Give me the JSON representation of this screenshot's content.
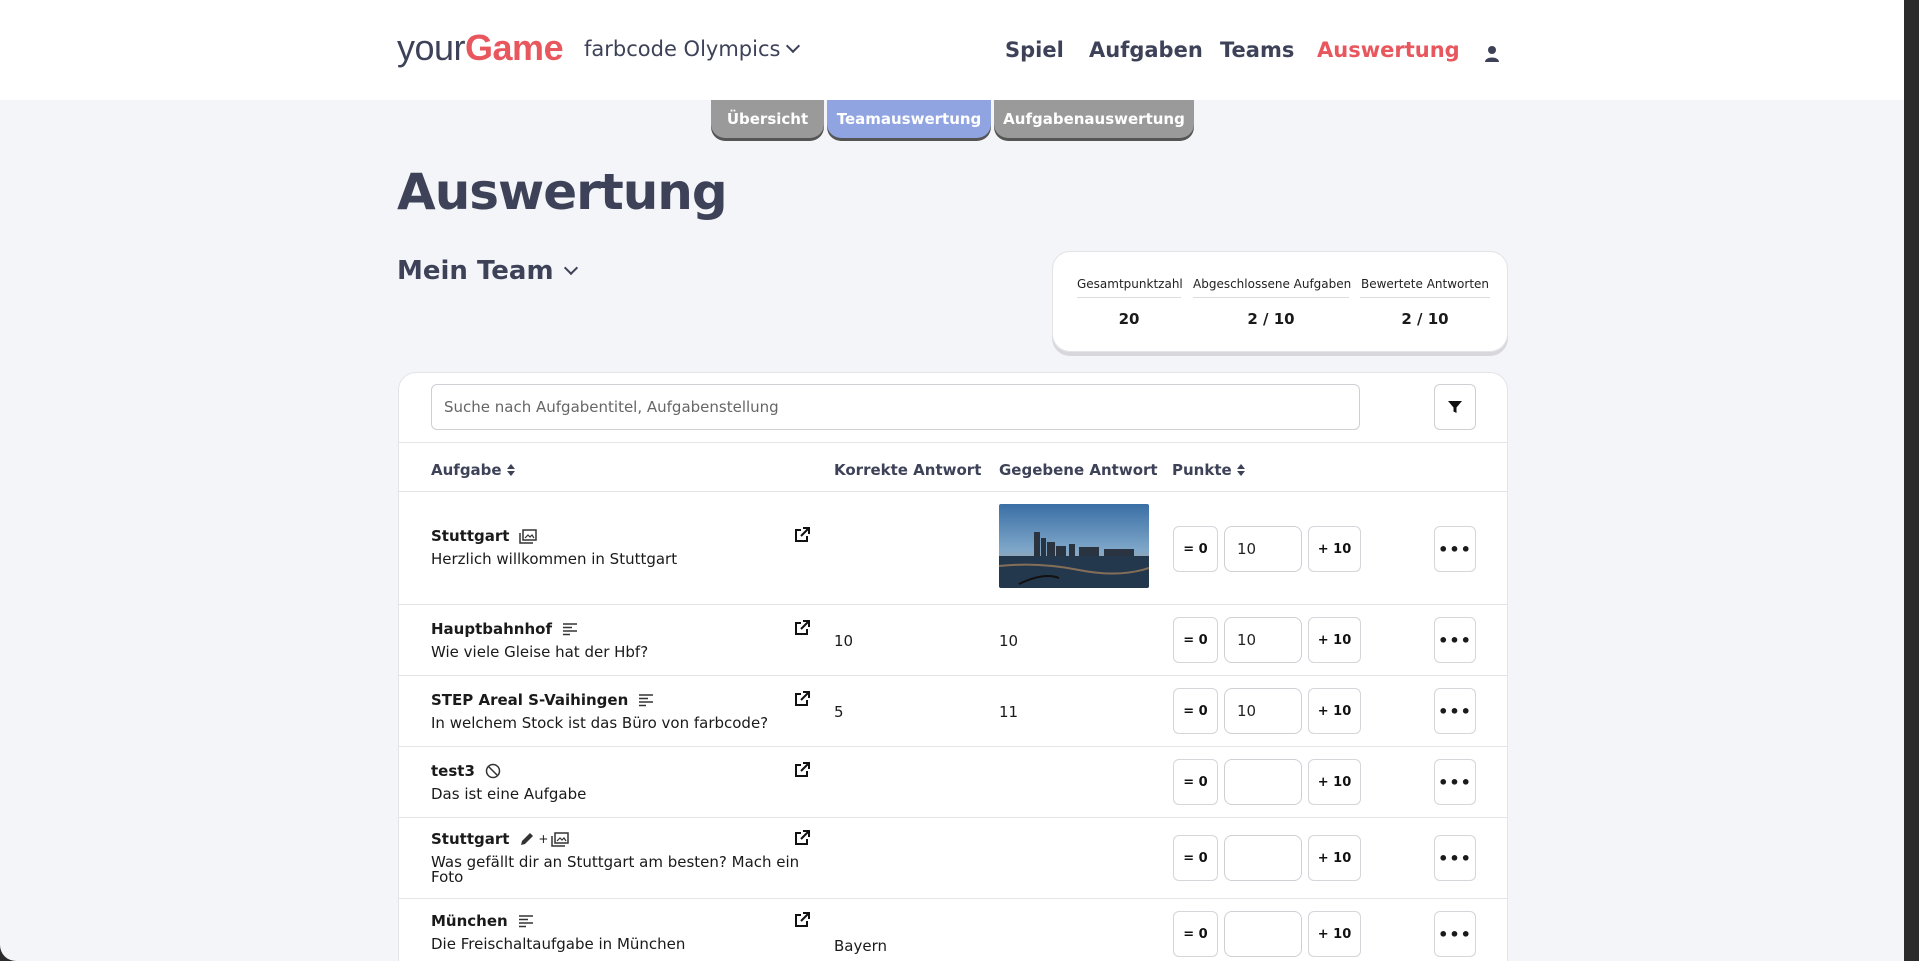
{
  "header": {
    "logo_part1": "your",
    "logo_part2": "Game",
    "game_name": "farbcode Olympics",
    "nav": [
      "Spiel",
      "Aufgaben",
      "Teams",
      "Auswertung"
    ],
    "active_nav": "Auswertung"
  },
  "tabs": [
    "Übersicht",
    "Teamauswertung",
    "Aufgabenauswertung"
  ],
  "active_tab": "Teamauswertung",
  "page_title": "Auswertung",
  "team_selector": "Mein Team",
  "stats": [
    {
      "label": "Gesamtpunktzahl",
      "value": "20"
    },
    {
      "label": "Abgeschlossene Aufgaben",
      "value": "2 / 10"
    },
    {
      "label": "Bewertete Antworten",
      "value": "2 / 10"
    }
  ],
  "search": {
    "placeholder": "Suche nach Aufgabentitel, Aufgabenstellung"
  },
  "table": {
    "headers": [
      "Aufgabe",
      "Korrekte Antwort",
      "Gegebene Antwort",
      "Punkte"
    ],
    "zero_label": "= 0",
    "plus_label": "+ 10",
    "more_label": "•••",
    "rows": [
      {
        "title": "Stuttgart",
        "type_icon": "image-icon",
        "description": "Herzlich willkommen in Stuttgart",
        "correct": "",
        "given": "",
        "given_is_image": true,
        "points": "10"
      },
      {
        "title": "Hauptbahnhof",
        "type_icon": "text-lines-icon",
        "description": "Wie viele Gleise hat der Hbf?",
        "correct": "10",
        "given": "10",
        "points": "10"
      },
      {
        "title": "STEP Areal S-Vaihingen",
        "type_icon": "text-lines-icon",
        "description": "In welchem Stock ist das Büro von farbcode?",
        "correct": "5",
        "given": "11",
        "points": "10"
      },
      {
        "title": "test3",
        "type_icon": "blocked-icon",
        "description": "Das ist eine Aufgabe",
        "correct": "",
        "given": "",
        "points": ""
      },
      {
        "title": "Stuttgart",
        "type_icon": "pencil-plus-image-icon",
        "type_plus": "+",
        "description": "Was gefällt dir an Stuttgart am besten? Mach ein Foto",
        "correct": "",
        "given": "",
        "points": ""
      },
      {
        "title": "München",
        "type_icon": "text-lines-icon",
        "description": "Die Freischaltaufgabe in München",
        "correct": "Bayern",
        "given": "",
        "points": ""
      }
    ]
  },
  "colors": {
    "brand": "#e8575e",
    "navy": "#3d4258",
    "tab_active": "#8fa4e0",
    "tab_inactive": "#9a9a9a"
  }
}
